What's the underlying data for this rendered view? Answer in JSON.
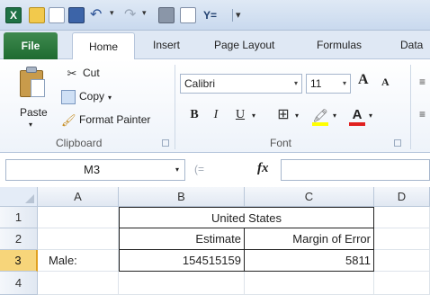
{
  "quick_access": {
    "app_logo_text": "X",
    "filter_text": "Y=",
    "icons": [
      "excel-logo-icon",
      "open-folder-icon",
      "new-file-icon",
      "save-icon",
      "undo-icon",
      "redo-icon",
      "quick-print-icon",
      "print-preview-icon",
      "filter-icon",
      "customize-toolbar-icon"
    ]
  },
  "tabs": [
    "File",
    "Home",
    "Insert",
    "Page Layout",
    "Formulas",
    "Data"
  ],
  "ribbon": {
    "clipboard": {
      "paste": "Paste",
      "cut": "Cut",
      "copy": "Copy",
      "format_painter": "Format Painter",
      "group_label": "Clipboard"
    },
    "font": {
      "font_name": "Calibri",
      "font_size": "11",
      "grow": "A",
      "shrink": "A",
      "bold": "B",
      "italic": "I",
      "underline": "U",
      "font_color_letter": "A",
      "group_label": "Font",
      "fill_color": "#ffff00",
      "font_color": "#e02020"
    }
  },
  "formula_bar": {
    "name_box": "M3",
    "fx": "fx",
    "value": ""
  },
  "sheet": {
    "columns": [
      "A",
      "B",
      "C",
      "D"
    ],
    "rows": [
      "1",
      "2",
      "3",
      "4"
    ],
    "selected_row": "3",
    "cells": {
      "B1": "United States",
      "B2": "Estimate",
      "C2": "Margin of Error",
      "A3": "Male:",
      "B3": "154515159",
      "C3": "5811"
    }
  }
}
